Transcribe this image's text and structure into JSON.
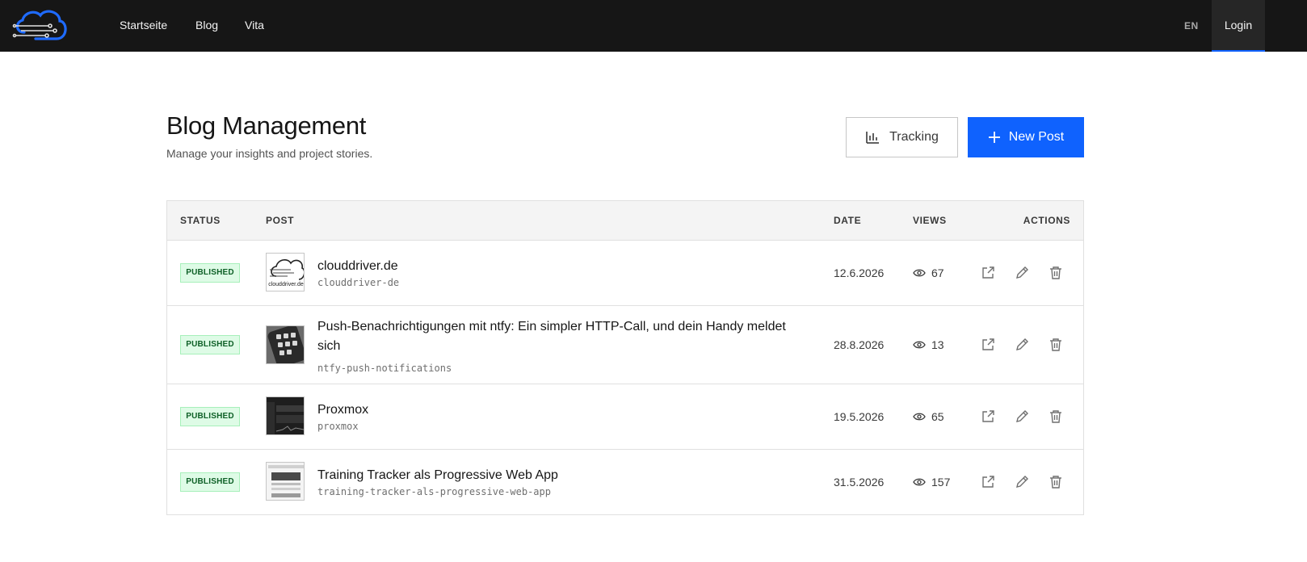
{
  "nav": {
    "links": [
      "Startseite",
      "Blog",
      "Vita"
    ],
    "lang": "EN",
    "login": "Login"
  },
  "header": {
    "title": "Blog Management",
    "subtitle": "Manage your insights and project stories.",
    "tracking_label": "Tracking",
    "new_post_label": "New Post"
  },
  "table": {
    "columns": [
      "STATUS",
      "POST",
      "DATE",
      "VIEWS",
      "ACTIONS"
    ],
    "rows": [
      {
        "status": "PUBLISHED",
        "title": "clouddriver.de",
        "slug": "clouddriver-de",
        "date": "12.6.2026",
        "views": "67",
        "thumb_text": "clouddriver.de"
      },
      {
        "status": "PUBLISHED",
        "title": "Push-Benachrichtigungen mit ntfy: Ein simpler HTTP-Call, und dein Handy meldet sich",
        "slug": "ntfy-push-notifications",
        "date": "28.8.2026",
        "views": "13"
      },
      {
        "status": "PUBLISHED",
        "title": "Proxmox",
        "slug": "proxmox",
        "date": "19.5.2026",
        "views": "65"
      },
      {
        "status": "PUBLISHED",
        "title": "Training Tracker als Progressive Web App",
        "slug": "training-tracker-als-progressive-web-app",
        "date": "31.5.2026",
        "views": "157"
      }
    ]
  },
  "colors": {
    "topbar": "#161616",
    "accent": "#0f62fe",
    "published_bg": "#defbe6",
    "published_text": "#0e6027"
  },
  "icons": [
    "cloud-logo-icon",
    "bar-chart-icon",
    "plus-icon",
    "eye-icon",
    "external-link-icon",
    "pencil-icon",
    "trash-icon"
  ]
}
